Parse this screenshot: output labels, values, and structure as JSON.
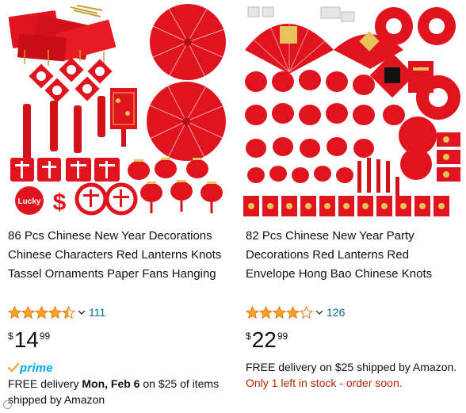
{
  "products": [
    {
      "title": "86 Pcs Chinese New Year Decorations Chinese Characters Red Lanterns Knots Tassel Ornaments Paper Fans Hanging Good Luck Ornaments for…",
      "rating": 4.5,
      "rating_count": "111",
      "price_symbol": "$",
      "price_whole": "14",
      "price_fraction": "99",
      "badge": "prime",
      "delivery_prefix": "FREE delivery ",
      "delivery_date": "Mon, Feb 6",
      "delivery_suffix": " on $25 of items shipped by Amazon",
      "image_texts": {
        "lucky": "Lucky",
        "dollar": "$"
      }
    },
    {
      "title": "82 Pcs Chinese New Year Party Decorations Red Lanterns Red Envelope Hong Bao Chinese Knots Tassel Chinese FU Character Paper…",
      "rating": 4.0,
      "rating_count": "126",
      "price_symbol": "$",
      "price_whole": "22",
      "price_fraction": "99",
      "delivery_text": "FREE delivery on $25 shipped by Amazon.",
      "stock_text": "Only 1 left in stock - order soon."
    }
  ],
  "colors": {
    "link": "#007185",
    "star": "#ffa41c",
    "prime": "#00a8e1",
    "stock_warning": "#b12704",
    "festive_red": "#e0141e"
  }
}
